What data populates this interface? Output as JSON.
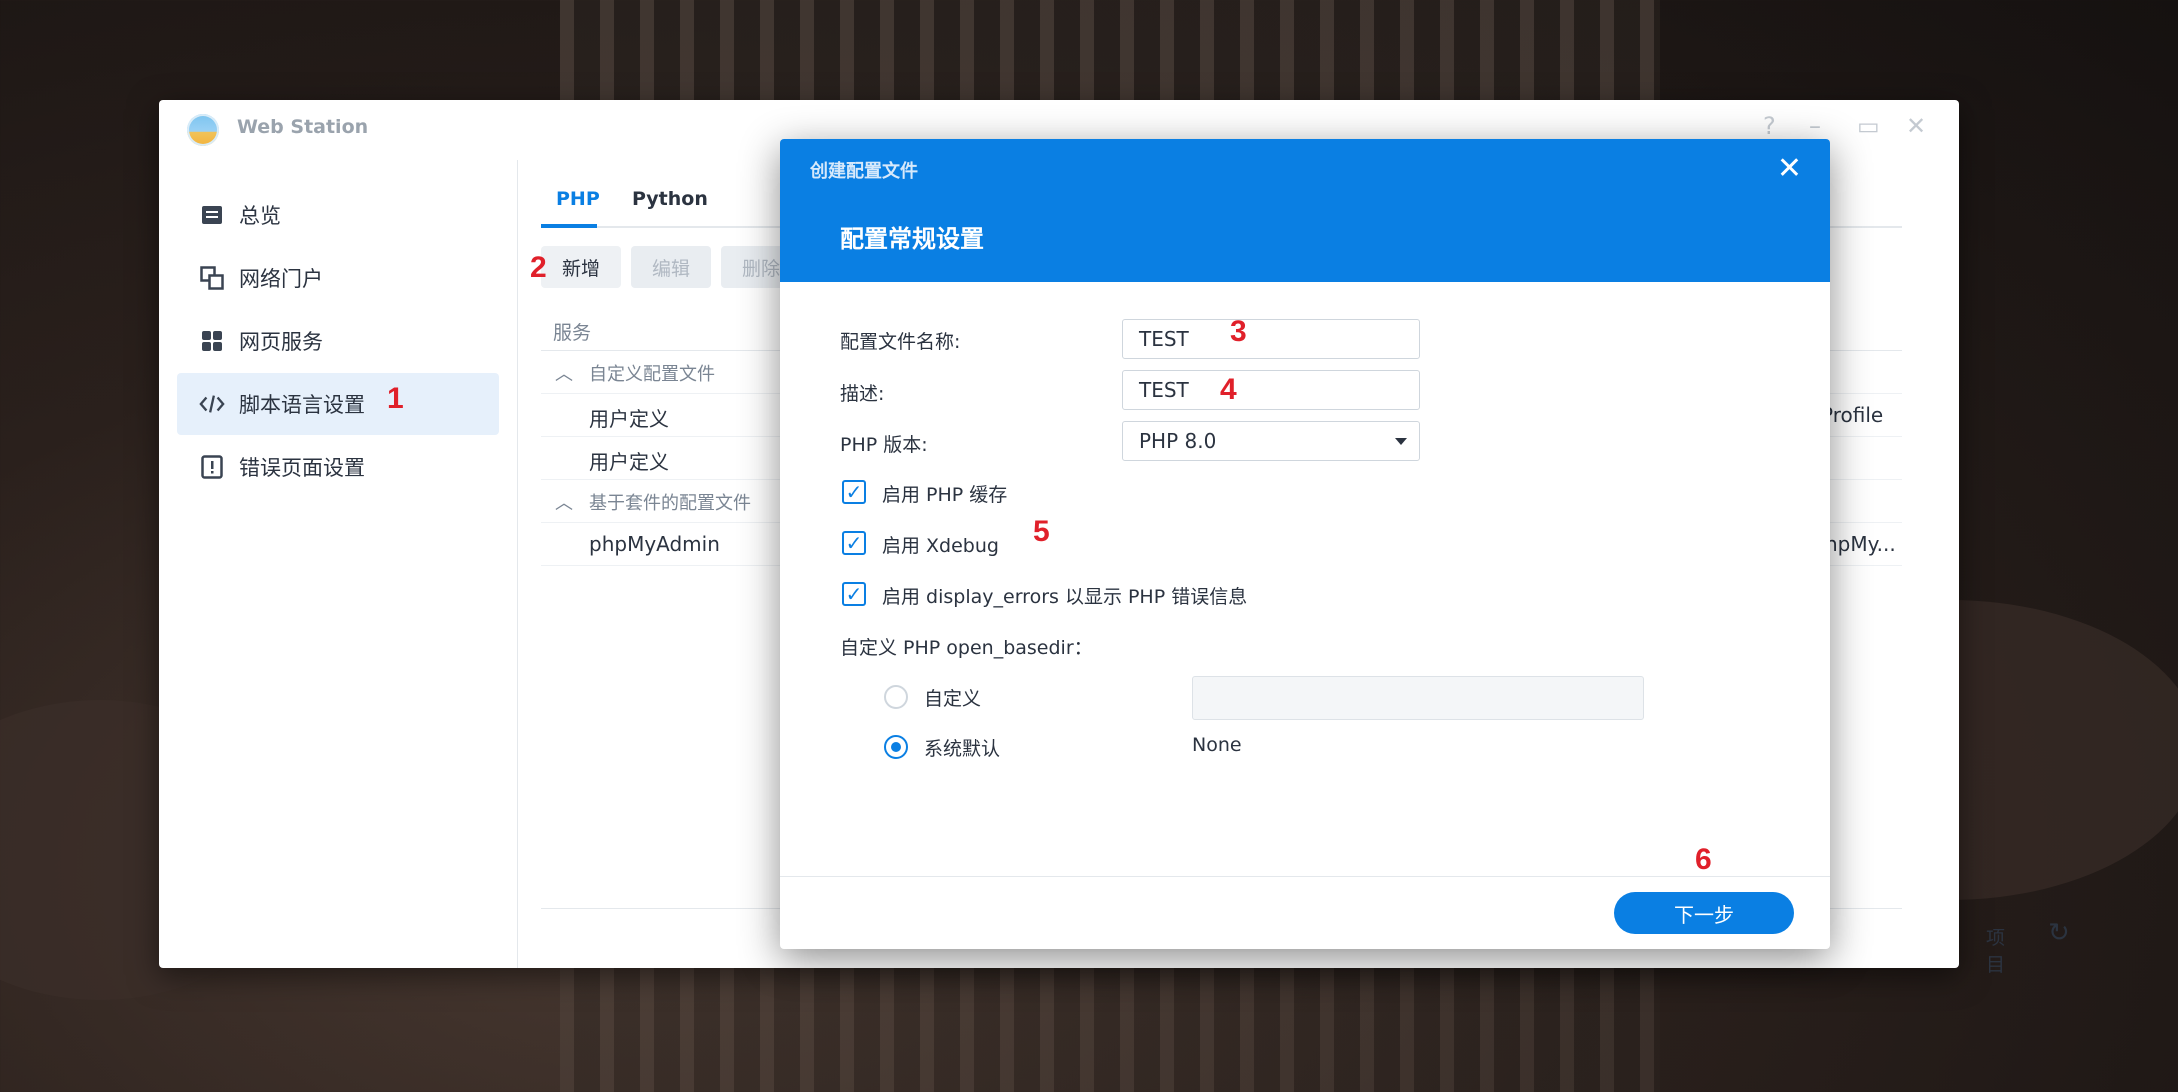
{
  "window": {
    "title": "Web Station"
  },
  "sidebar": {
    "items": [
      {
        "label": "总览",
        "icon": "overview-icon"
      },
      {
        "label": "网络门户",
        "icon": "portal-icon"
      },
      {
        "label": "网页服务",
        "icon": "services-icon"
      },
      {
        "label": "脚本语言设置",
        "icon": "code-icon",
        "active": true
      },
      {
        "label": "错误页面设置",
        "icon": "error-page-icon"
      }
    ]
  },
  "tabs": [
    {
      "label": "PHP",
      "active": true
    },
    {
      "label": "Python",
      "active": false
    }
  ],
  "toolbar": {
    "add_label": "新增",
    "edit_label": "编辑",
    "delete_label": "删除"
  },
  "grid": {
    "header_service": "服务",
    "group_custom": "自定义配置文件",
    "row1": "用户定义",
    "row2": "用户定义",
    "group_package": "基于套件的配置文件",
    "row3": "phpMyAdmin",
    "right_profile": "Profile",
    "right_pma": "hpMy...",
    "footer_items": "项目"
  },
  "annotations": {
    "a1": "1",
    "a2": "2",
    "a3": "3",
    "a4": "4",
    "a5": "5",
    "a6": "6"
  },
  "modal": {
    "title": "创建配置文件",
    "step_title": "配置常规设置",
    "name_label": "配置文件名称:",
    "name_value": "TEST",
    "desc_label": "描述:",
    "desc_value": "TEST",
    "php_version_label": "PHP 版本:",
    "php_version_value": "PHP 8.0",
    "cb_cache": "启用 PHP 缓存",
    "cb_xdebug": "启用 Xdebug",
    "cb_display_errors": "启用 display_errors 以显示 PHP 错误信息",
    "open_basedir_label": "自定义 PHP open_basedir：",
    "radio_custom": "自定义",
    "radio_default": "系统默认",
    "default_value": "None",
    "next_label": "下一步"
  },
  "colors": {
    "accent": "#0a7fe3",
    "annotation": "#e0202a"
  }
}
